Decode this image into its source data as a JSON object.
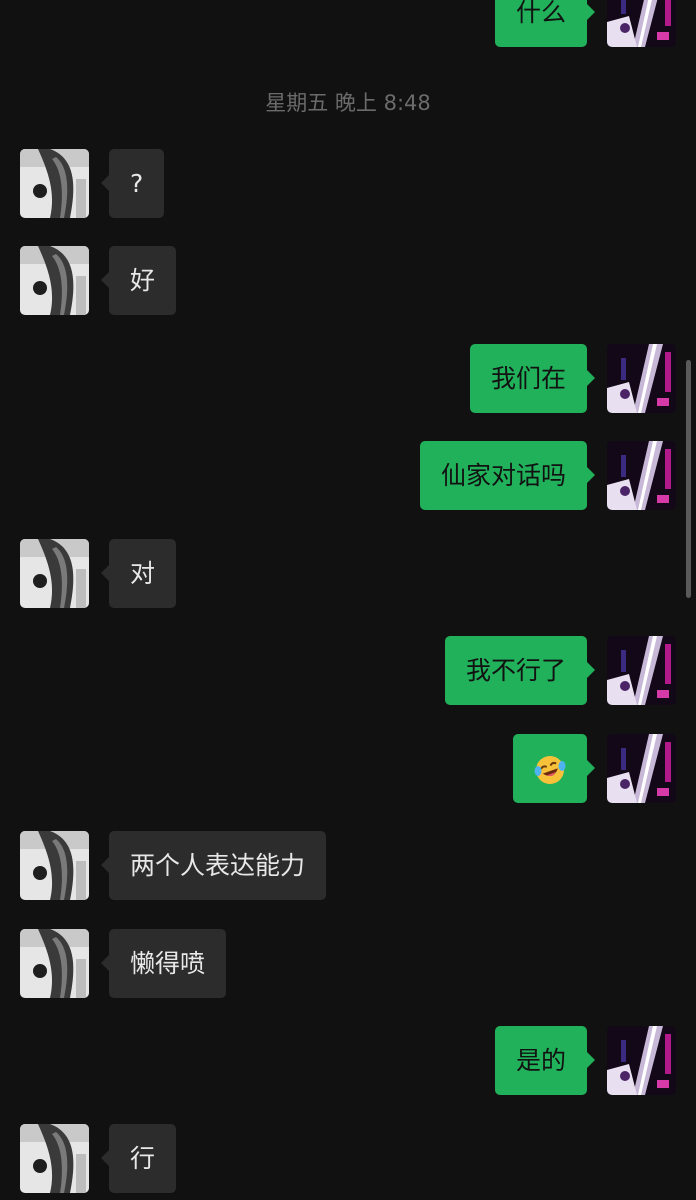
{
  "timestamp": "星期五 晚上 8:48",
  "messages": [
    {
      "side": "out",
      "text": "什么"
    },
    {
      "side": "in",
      "text": "?"
    },
    {
      "side": "in",
      "text": "好"
    },
    {
      "side": "out",
      "text": "我们在"
    },
    {
      "side": "out",
      "text": "仙家对话吗"
    },
    {
      "side": "in",
      "text": "对"
    },
    {
      "side": "out",
      "text": "我不行了"
    },
    {
      "side": "out",
      "text": "",
      "emoji": "laughing-crying-emoji"
    },
    {
      "side": "in",
      "text": "两个人表达能力"
    },
    {
      "side": "in",
      "text": "懒得喷"
    },
    {
      "side": "out",
      "text": "是的"
    },
    {
      "side": "in",
      "text": "行"
    }
  ],
  "colors": {
    "background": "#111111",
    "incoming_bubble": "#2c2c2c",
    "outgoing_bubble": "#20b15a"
  }
}
